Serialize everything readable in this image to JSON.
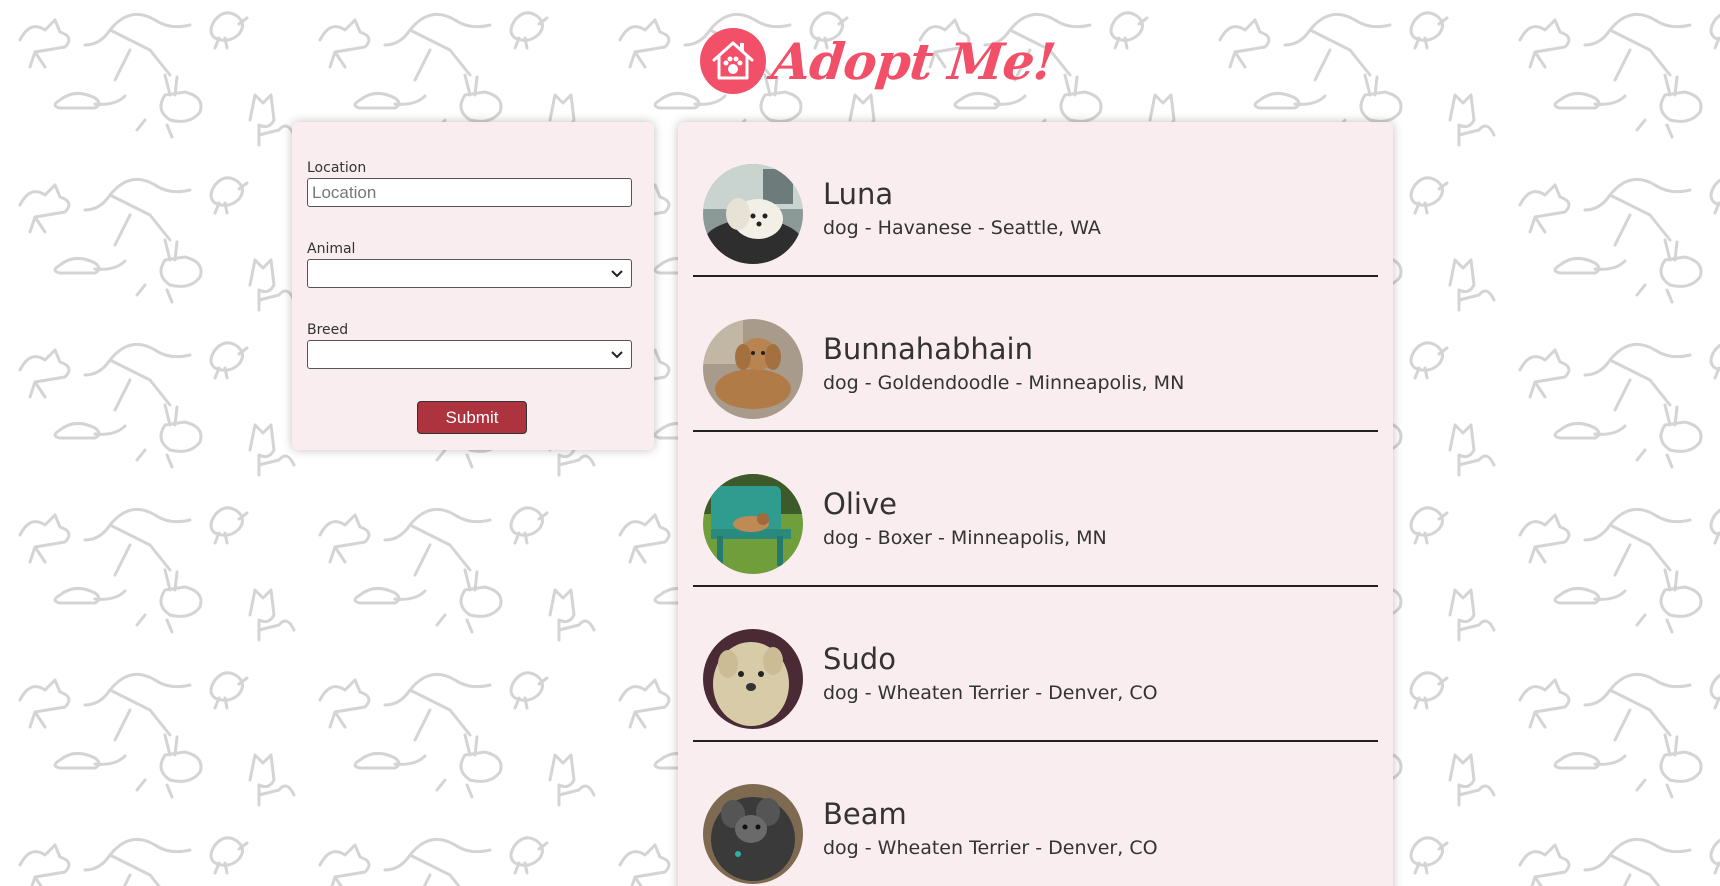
{
  "app": {
    "title": "Adopt Me!",
    "brand_color": "#f25068"
  },
  "search": {
    "location_label": "Location",
    "location_placeholder": "Location",
    "location_value": "",
    "animal_label": "Animal",
    "animal_value": "",
    "breed_label": "Breed",
    "breed_value": "",
    "submit_label": "Submit",
    "submit_color": "#ad343e"
  },
  "pets": [
    {
      "name": "Luna",
      "info": "dog - Havanese - Seattle, WA",
      "photo_icon": "havanese-dog-photo"
    },
    {
      "name": "Bunnahabhain",
      "info": "dog - Goldendoodle - Minneapolis, MN",
      "photo_icon": "goldendoodle-dog-photo"
    },
    {
      "name": "Olive",
      "info": "dog - Boxer - Minneapolis, MN",
      "photo_icon": "boxer-dog-photo"
    },
    {
      "name": "Sudo",
      "info": "dog - Wheaten Terrier - Denver, CO",
      "photo_icon": "wheaten-terrier-dog-photo"
    },
    {
      "name": "Beam",
      "info": "dog - Wheaten Terrier - Denver, CO",
      "photo_icon": "wheaten-terrier-dog-photo"
    }
  ]
}
